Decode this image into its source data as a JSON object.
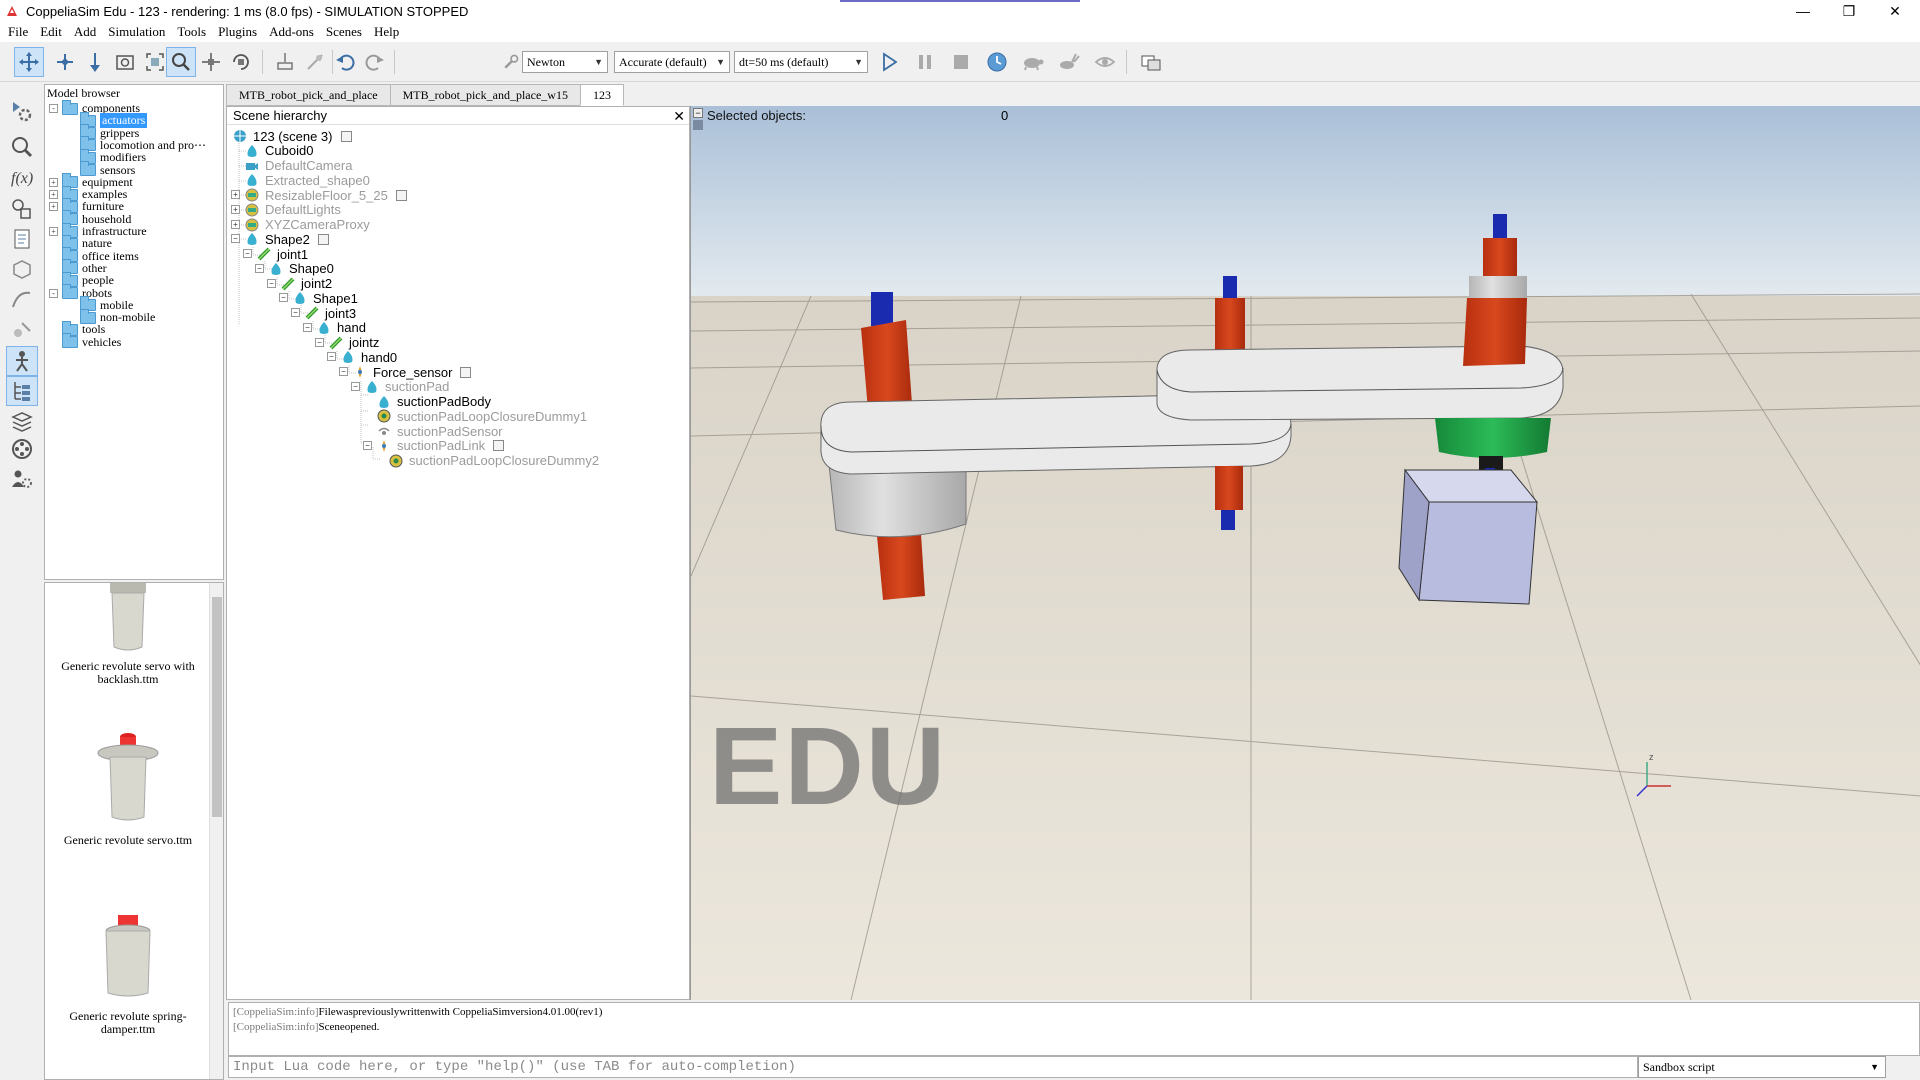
{
  "window": {
    "title": "CoppeliaSim Edu - 123 - rendering: 1 ms (8.0 fps) - SIMULATION STOPPED",
    "minimize": "—",
    "restore": "❐",
    "close": "✕"
  },
  "menu": [
    "File",
    "Edit",
    "Add",
    "Simulation",
    "Tools",
    "Plugins",
    "Add-ons",
    "Scenes",
    "Help"
  ],
  "toolbar": {
    "engine": "Newton",
    "accuracy": "Accurate (default)",
    "timestep": "dt=50 ms (default)"
  },
  "model_browser": {
    "title": "Model browser",
    "items": [
      {
        "label": "components",
        "level": 0,
        "expand": "-"
      },
      {
        "label": "actuators",
        "level": 1,
        "selected": true
      },
      {
        "label": "grippers",
        "level": 1
      },
      {
        "label": "locomotion and pro⋯",
        "level": 1
      },
      {
        "label": "modifiers",
        "level": 1
      },
      {
        "label": "sensors",
        "level": 1
      },
      {
        "label": "equipment",
        "level": 0,
        "expand": "+"
      },
      {
        "label": "examples",
        "level": 0,
        "expand": "+"
      },
      {
        "label": "furniture",
        "level": 0,
        "expand": "+"
      },
      {
        "label": "household",
        "level": 0
      },
      {
        "label": "infrastructure",
        "level": 0,
        "expand": "+"
      },
      {
        "label": "nature",
        "level": 0
      },
      {
        "label": "office items",
        "level": 0
      },
      {
        "label": "other",
        "level": 0
      },
      {
        "label": "people",
        "level": 0
      },
      {
        "label": "robots",
        "level": 0,
        "expand": "-"
      },
      {
        "label": "mobile",
        "level": 1
      },
      {
        "label": "non-mobile",
        "level": 1
      },
      {
        "label": "tools",
        "level": 0
      },
      {
        "label": "vehicles",
        "level": 0
      }
    ],
    "thumbnails": [
      "Generic revolute servo with backlash.ttm",
      "Generic revolute servo.ttm",
      "Generic revolute spring-damper.ttm"
    ]
  },
  "scene_tabs": [
    "MTB_robot_pick_and_place",
    "MTB_robot_pick_and_place_w15",
    "123"
  ],
  "hierarchy": {
    "title": "Scene hierarchy",
    "rows": [
      {
        "label": "123 (scene 3)",
        "indent": 0,
        "icon": "scene",
        "dim": false
      },
      {
        "label": "Cuboid0",
        "indent": 1,
        "icon": "shape",
        "dim": false
      },
      {
        "label": "DefaultCamera",
        "indent": 1,
        "icon": "camera",
        "dim": true
      },
      {
        "label": "Extracted_shape0",
        "indent": 1,
        "icon": "shape",
        "dim": true
      },
      {
        "label": "ResizableFloor_5_25",
        "indent": 1,
        "icon": "model",
        "dim": true
      },
      {
        "label": "DefaultLights",
        "indent": 1,
        "icon": "model",
        "dim": true
      },
      {
        "label": "XYZCameraProxy",
        "indent": 1,
        "icon": "model",
        "dim": true
      },
      {
        "label": "Shape2",
        "indent": 1,
        "icon": "shape",
        "dim": false
      },
      {
        "label": "joint1",
        "indent": 2,
        "icon": "joint",
        "dim": false
      },
      {
        "label": "Shape0",
        "indent": 3,
        "icon": "shape",
        "dim": false
      },
      {
        "label": "joint2",
        "indent": 4,
        "icon": "joint",
        "dim": false
      },
      {
        "label": "Shape1",
        "indent": 5,
        "icon": "shape",
        "dim": false
      },
      {
        "label": "joint3",
        "indent": 6,
        "icon": "joint",
        "dim": false
      },
      {
        "label": "hand",
        "indent": 7,
        "icon": "shape",
        "dim": false
      },
      {
        "label": "jointz",
        "indent": 8,
        "icon": "joint",
        "dim": false
      },
      {
        "label": "hand0",
        "indent": 9,
        "icon": "shape",
        "dim": false
      },
      {
        "label": "Force_sensor",
        "indent": 10,
        "icon": "force",
        "dim": false
      },
      {
        "label": "suctionPad",
        "indent": 11,
        "icon": "shape",
        "dim": true
      },
      {
        "label": "suctionPadBody",
        "indent": 12,
        "icon": "shape",
        "dim": false
      },
      {
        "label": "suctionPadLoopClosureDummy1",
        "indent": 12,
        "icon": "dummy",
        "dim": true
      },
      {
        "label": "suctionPadSensor",
        "indent": 12,
        "icon": "sensor",
        "dim": true
      },
      {
        "label": "suctionPadLink",
        "indent": 12,
        "icon": "force",
        "dim": true
      },
      {
        "label": "suctionPadLoopClosureDummy2",
        "indent": 13,
        "icon": "dummy",
        "dim": true
      }
    ]
  },
  "viewport": {
    "selected_label": "Selected objects:",
    "selected_count": "0",
    "watermark": "EDU"
  },
  "console": {
    "lines": [
      {
        "tag": "[CoppeliaSim:info]",
        "text": "Filewaspreviouslywrittenwith CoppeliaSimversion4.01.00(rev1)"
      },
      {
        "tag": "[CoppeliaSim:info]",
        "text": "Sceneopened."
      }
    ]
  },
  "lua_input": {
    "placeholder": "Input Lua code here, or type \"help()\" (use TAB for auto-completion)"
  },
  "script_select": "Sandbox script"
}
